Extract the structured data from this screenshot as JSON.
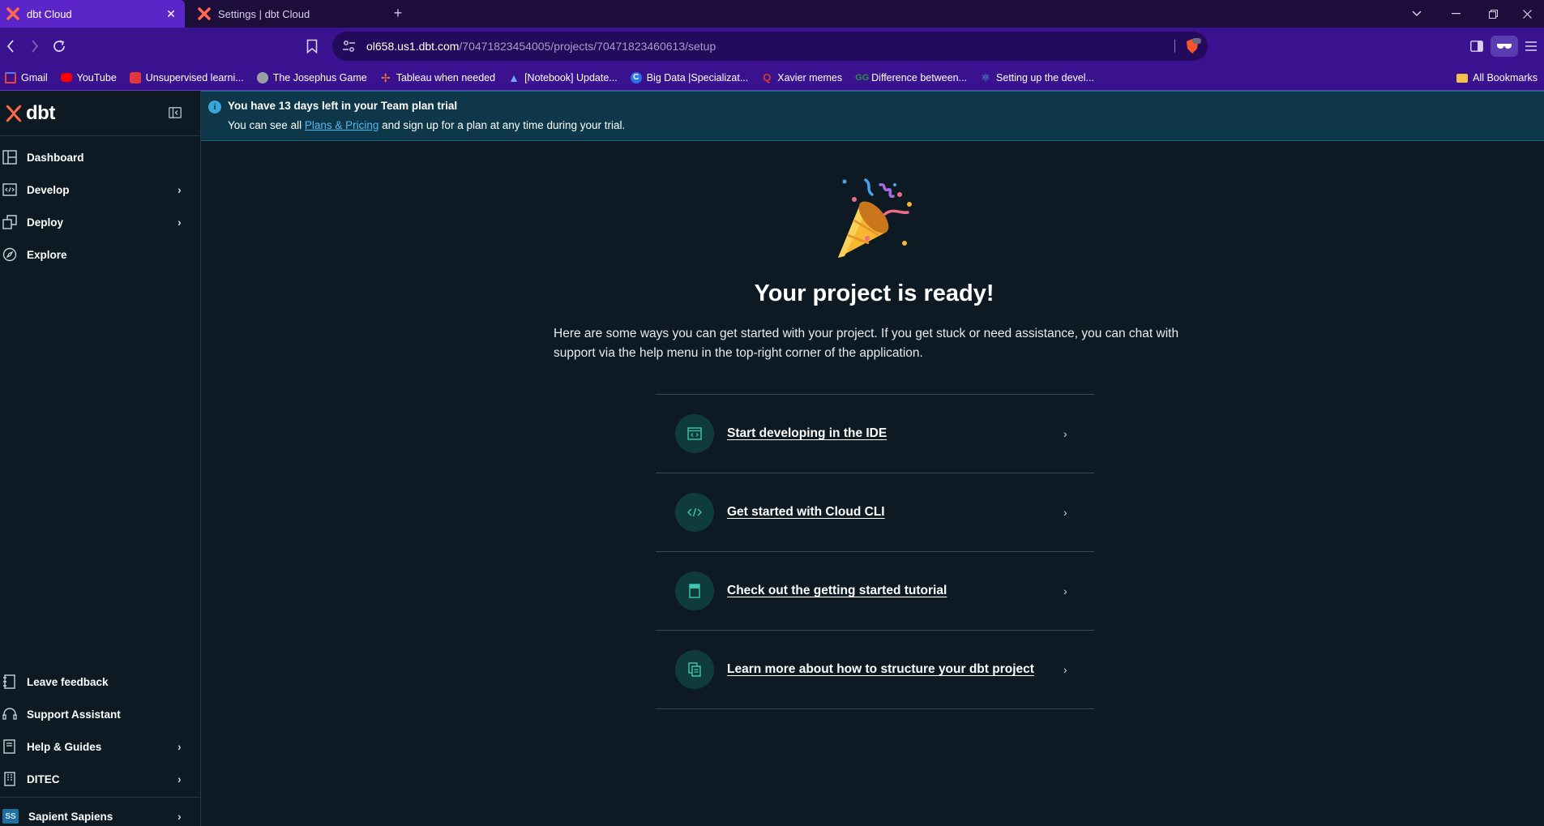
{
  "browser": {
    "tabs": [
      {
        "title": "dbt Cloud",
        "active": true
      },
      {
        "title": "Settings | dbt Cloud",
        "active": false
      }
    ],
    "url_host": "ol658.us1.dbt.com",
    "url_path": "/70471823454005/projects/70471823460613/setup",
    "bookmarks": [
      {
        "label": "Gmail",
        "icon": "gmail-icon",
        "color": "#ea4335"
      },
      {
        "label": "YouTube",
        "icon": "youtube-icon",
        "color": "#ff0000"
      },
      {
        "label": "Unsupervised learni...",
        "icon": "tb-icon",
        "color": "#e0363c"
      },
      {
        "label": "The Josephus Game",
        "icon": "globe-icon",
        "color": "#9aa0a6"
      },
      {
        "label": "Tableau when needed",
        "icon": "tableau-icon",
        "color": "#e8762d"
      },
      {
        "label": "[Notebook] Update...",
        "icon": "arrow-a-icon",
        "color": "#6fa8ff"
      },
      {
        "label": "Big Data |Specializat...",
        "icon": "coursera-icon",
        "color": "#2a73e8"
      },
      {
        "label": "Xavier memes",
        "icon": "quora-icon",
        "color": "#d33a2c"
      },
      {
        "label": "Difference between...",
        "icon": "gfg-icon",
        "color": "#2f8d46"
      },
      {
        "label": "Setting up the devel...",
        "icon": "react-icon",
        "color": "#58c4dc"
      }
    ],
    "all_bookmarks_label": "All Bookmarks"
  },
  "sidebar": {
    "logo": "dbt",
    "nav": [
      {
        "label": "Dashboard",
        "icon": "dashboard-icon",
        "chevron": false
      },
      {
        "label": "Develop",
        "icon": "develop-icon",
        "chevron": true
      },
      {
        "label": "Deploy",
        "icon": "deploy-icon",
        "chevron": true
      },
      {
        "label": "Explore",
        "icon": "explore-icon",
        "chevron": false
      }
    ],
    "bottom": [
      {
        "label": "Leave feedback",
        "icon": "feedback-icon",
        "chevron": false
      },
      {
        "label": "Support Assistant",
        "icon": "headset-icon",
        "chevron": false
      },
      {
        "label": "Help & Guides",
        "icon": "book-icon",
        "chevron": true
      },
      {
        "label": "DITEC",
        "icon": "building-icon",
        "chevron": true
      }
    ],
    "account": {
      "initials": "SS",
      "label": "Sapient Sapiens"
    }
  },
  "banner": {
    "title": "You have 13 days left in your Team plan trial",
    "text_before": "You can see all ",
    "link": "Plans & Pricing",
    "text_after": " and sign up for a plan at any time during your trial."
  },
  "main": {
    "headline": "Your project is ready!",
    "intro": "Here are some ways you can get started with your project. If you get stuck or need assistance, you can chat with support via the help menu in the top-right corner of the application.",
    "options": [
      {
        "label": "Start developing in the IDE",
        "icon": "ide-icon"
      },
      {
        "label": "Get started with Cloud CLI",
        "icon": "code-icon"
      },
      {
        "label": "Check out the getting started tutorial",
        "icon": "bookmark-icon"
      },
      {
        "label": "Learn more about how to structure your dbt project",
        "icon": "files-icon"
      }
    ]
  },
  "colors": {
    "background": "#0d1a24",
    "banner_bg": "#0e3849",
    "link": "#52b8f0",
    "accent_teal": "#3cc6b2",
    "dbt_orange": "#ff694a",
    "tab_active": "#5b25c7"
  }
}
